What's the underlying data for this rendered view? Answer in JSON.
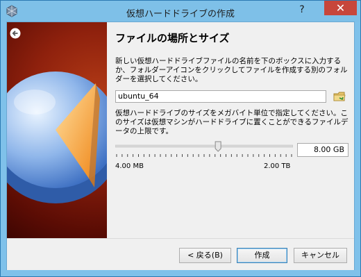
{
  "window": {
    "title": "仮想ハードドライブの作成",
    "help_label": "?",
    "close_label": "✕"
  },
  "page": {
    "heading": "ファイルの場所とサイズ",
    "location_description": "新しい仮想ハードドライブファイルの名前を下のボックスに入力するか、フォルダーアイコンをクリックしてファイルを作成する別のフォルダーを選択してください。",
    "file_name_value": "ubuntu_64",
    "size_description": "仮想ハードドライブのサイズをメガバイト単位で指定してください。このサイズは仮想マシンがハードドライブに置くことができるファイルデータの上限です。",
    "size_value": "8.00 GB",
    "slider_min_label": "4.00 MB",
    "slider_max_label": "2.00 TB",
    "slider_position_fraction": 0.58
  },
  "buttons": {
    "back_label": "< 戻る(B)",
    "create_label": "作成",
    "cancel_label": "キャンセル"
  },
  "colors": {
    "titlebar": "#7ec0e8",
    "close": "#c7463b",
    "banner": "#8f210d",
    "pie_blue": "#4f86d6",
    "pie_orange": "#f2a33a"
  }
}
